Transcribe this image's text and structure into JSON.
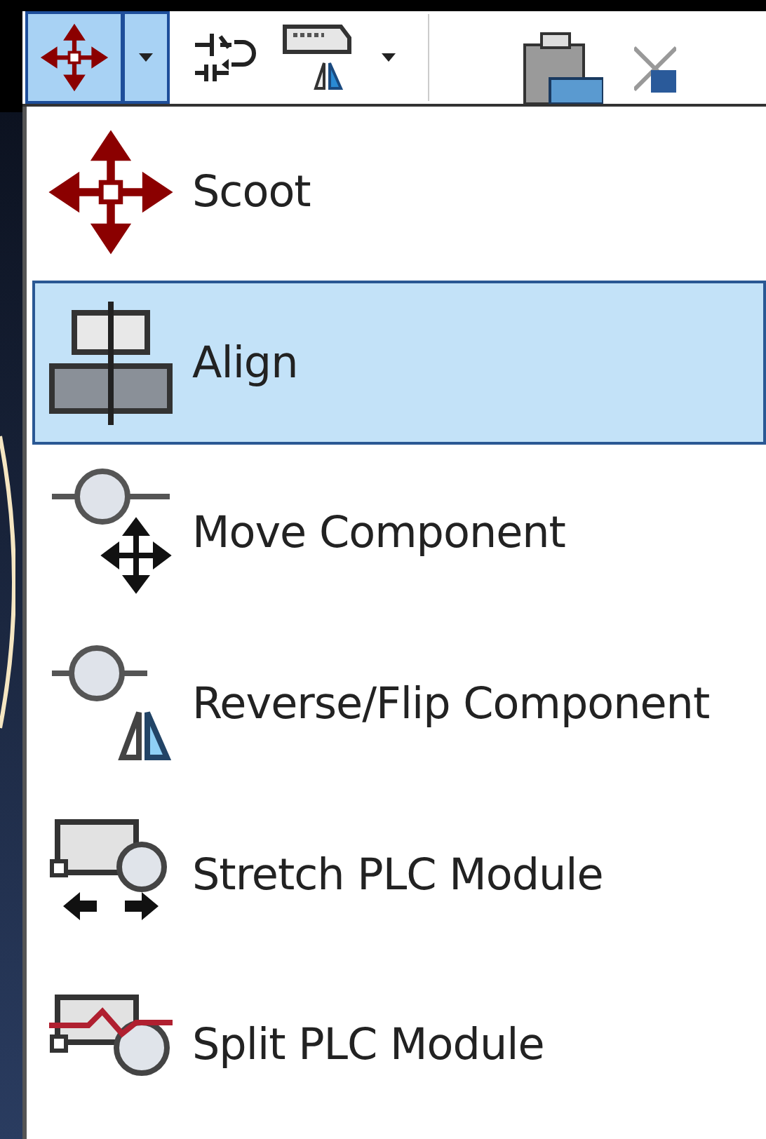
{
  "toolbar": {
    "split_button": {
      "expanded": true
    },
    "dropdowns": [
      {
        "expanded": false
      }
    ]
  },
  "menu": {
    "items": [
      {
        "label": "Scoot",
        "selected": false
      },
      {
        "label": "Align",
        "selected": true
      },
      {
        "label": "Move Component",
        "selected": false
      },
      {
        "label": "Reverse/Flip Component",
        "selected": false
      },
      {
        "label": "Stretch PLC Module",
        "selected": false
      },
      {
        "label": "Split PLC Module",
        "selected": false
      }
    ]
  }
}
